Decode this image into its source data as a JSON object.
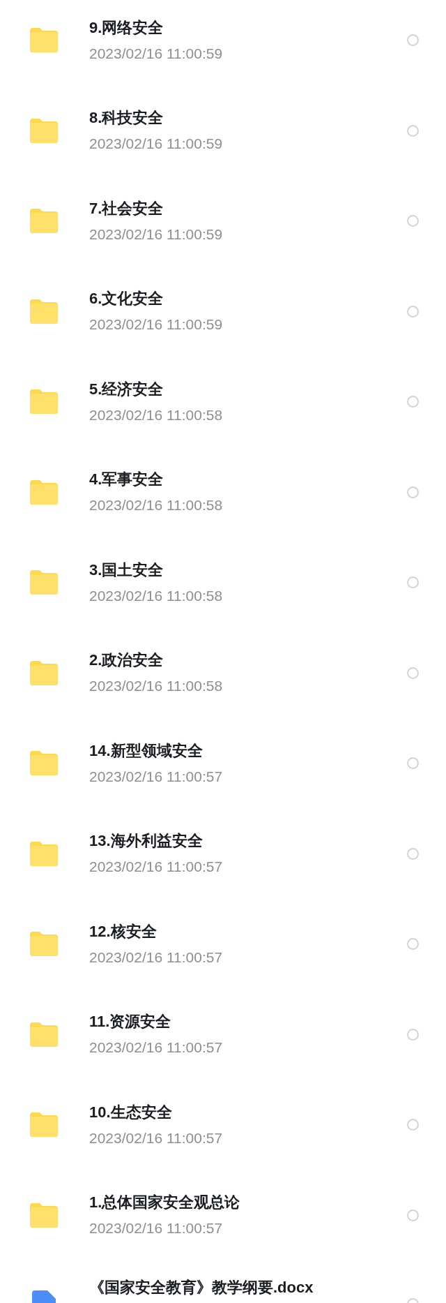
{
  "files": [
    {
      "kind": "folder",
      "name": "9.网络安全",
      "date": "2023/02/16 11:00:59",
      "selected": false
    },
    {
      "kind": "folder",
      "name": "8.科技安全",
      "date": "2023/02/16 11:00:59",
      "selected": false
    },
    {
      "kind": "folder",
      "name": "7.社会安全",
      "date": "2023/02/16 11:00:59",
      "selected": false
    },
    {
      "kind": "folder",
      "name": "6.文化安全",
      "date": "2023/02/16 11:00:59",
      "selected": false
    },
    {
      "kind": "folder",
      "name": "5.经济安全",
      "date": "2023/02/16 11:00:58",
      "selected": false
    },
    {
      "kind": "folder",
      "name": "4.军事安全",
      "date": "2023/02/16 11:00:58",
      "selected": false
    },
    {
      "kind": "folder",
      "name": "3.国土安全",
      "date": "2023/02/16 11:00:58",
      "selected": false
    },
    {
      "kind": "folder",
      "name": "2.政治安全",
      "date": "2023/02/16 11:00:58",
      "selected": false
    },
    {
      "kind": "folder",
      "name": "14.新型领域安全",
      "date": "2023/02/16 11:00:57",
      "selected": false
    },
    {
      "kind": "folder",
      "name": "13.海外利益安全",
      "date": "2023/02/16 11:00:57",
      "selected": false
    },
    {
      "kind": "folder",
      "name": "12.核安全",
      "date": "2023/02/16 11:00:57",
      "selected": false
    },
    {
      "kind": "folder",
      "name": "11.资源安全",
      "date": "2023/02/16 11:00:57",
      "selected": false
    },
    {
      "kind": "folder",
      "name": "10.生态安全",
      "date": "2023/02/16 11:00:57",
      "selected": false
    },
    {
      "kind": "folder",
      "name": "1.总体国家安全观总论",
      "date": "2023/02/16 11:00:57",
      "selected": false
    },
    {
      "kind": "docx",
      "name": "《国家安全教育》教学纲要.docx",
      "selected": false
    }
  ]
}
